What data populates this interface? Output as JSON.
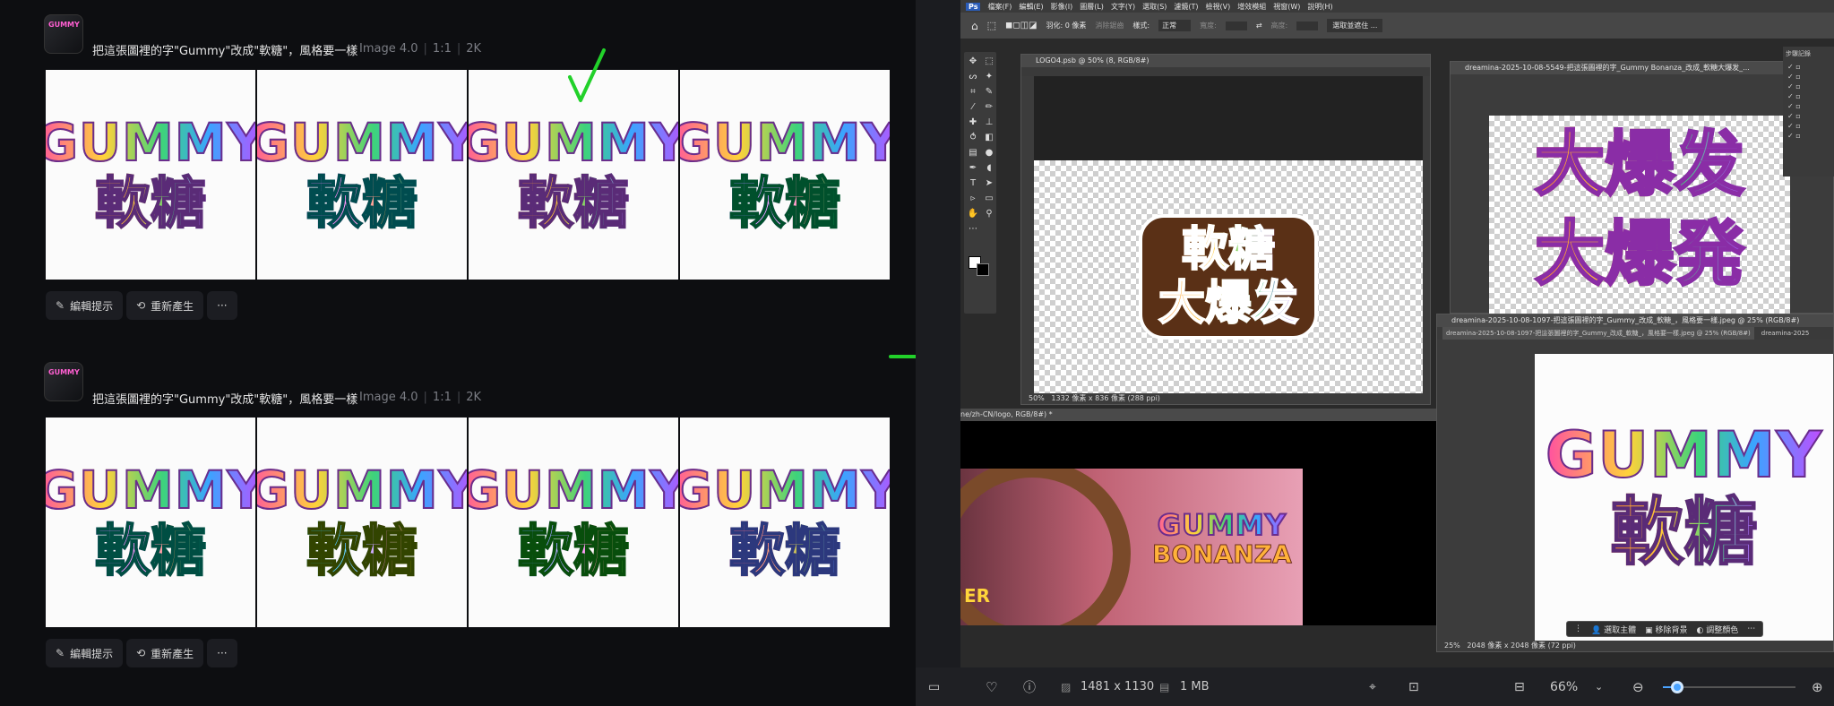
{
  "left": {
    "rows": [
      {
        "avatar_text": "GUMMY",
        "prompt": "把這張圖裡的字\"Gummy\"改成\"軟糖\"，風格要一樣",
        "model": "Image 4.0",
        "ratio": "1:1",
        "resolution": "2K",
        "images": [
          {
            "en": "GUMMY",
            "zh": "軟糖"
          },
          {
            "en": "GUMMY",
            "zh": "軟糖"
          },
          {
            "en": "GUMMY",
            "zh": "軟糖"
          },
          {
            "en": "GUMMY",
            "zh": "軟糖"
          }
        ],
        "edit_label": "編輯提示",
        "regen_label": "重新產生",
        "more_label": "···"
      },
      {
        "avatar_text": "GUMMY",
        "prompt": "把這張圖裡的字\"Gummy\"改成\"軟糖\"，風格要一樣",
        "model": "Image 4.0",
        "ratio": "1:1",
        "resolution": "2K",
        "images": [
          {
            "en": "GUMMY",
            "zh": "軟糖"
          },
          {
            "en": "GUMMY",
            "zh": "軟糖"
          },
          {
            "en": "GUMMY",
            "zh": "軟糖"
          },
          {
            "en": "GUMMY",
            "zh": "軟糖"
          }
        ],
        "edit_label": "編輯提示",
        "regen_label": "重新產生",
        "more_label": "···"
      }
    ],
    "annotation_check": "√",
    "annotation_arrow": "→"
  },
  "ps": {
    "menu": [
      "檔案(F)",
      "編輯(E)",
      "影像(I)",
      "圖層(L)",
      "文字(Y)",
      "選取(S)",
      "濾鏡(T)",
      "檢視(V)",
      "增效模組",
      "視窗(W)",
      "說明(H)"
    ],
    "options": {
      "feather": "羽化: 0 像素",
      "anti_alias": "消除鋸齒",
      "style_label": "樣式:",
      "style_value": "正常",
      "width_label": "寬度:",
      "height_label": "高度:",
      "select_mask": "選取並遮住 ..."
    },
    "doc1": {
      "title": "LOGO4.psb @ 50% (8, RGB/8#)",
      "line1": "軟糖",
      "line2": "大爆发",
      "zoom": "50%",
      "size": "1332 像素 x 836 像素 (288 ppi)"
    },
    "doc2": {
      "title": "dreamina-2025-10-08-5549-把這張圖裡的字_Gummy Bonanza_改成_軟糖大爆发_...",
      "line1": "大爆发",
      "line2": "大爆発"
    },
    "doc3": {
      "title": "dreamina-2025-10-08-1097-把這張圖裡的字_Gummy_改成_軟糖_，風格要一樣.jpeg @ 25% (RGB/8#)",
      "tab1": "dreamina-2025-10-08-1097-把這張圖裡的字_Gummy_改成_軟糖_，風格要一樣.jpeg @ 25% (RGB/8#)",
      "tab2": "dreamina-2025",
      "en": "GUMMY",
      "zh": "軟糖",
      "zoom": "25%",
      "size": "2048 像素 x 2048 像素 (72 ppi)",
      "ctx": [
        "選取主體",
        "移除背景",
        "調整顏色"
      ]
    },
    "doc4": {
      "title": "ne/zh-CN/logo, RGB/8#) *",
      "en1": "GUMMY",
      "en2": "BONANZA",
      "side": "ER"
    },
    "panel_title": "步驟記錄"
  },
  "viewer": {
    "dimensions": "1481 x 1130",
    "filesize": "1 MB",
    "zoom": "66%"
  }
}
